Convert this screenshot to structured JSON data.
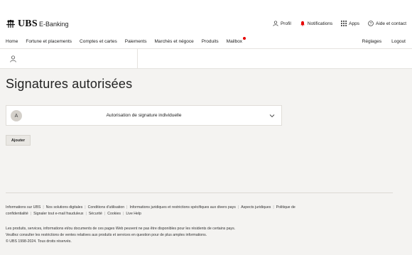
{
  "header": {
    "brand": "UBS",
    "app_name": "E-Banking",
    "actions": {
      "profile": "Profil",
      "notifications": "Notifications",
      "apps": "Apps",
      "help": "Aide et contact"
    },
    "icons": [
      "user-icon",
      "bell-icon",
      "grid-icon",
      "help-circle-icon"
    ],
    "accent_color": "#e60000"
  },
  "nav": {
    "items": [
      "Home",
      "Fortune et placements",
      "Comptes et cartes",
      "Paiements",
      "Marchés et négoce",
      "Produits",
      "Mailbox"
    ],
    "right": [
      "Réglages",
      "Logout"
    ]
  },
  "page": {
    "title": "Signatures autorisées",
    "signature": {
      "avatar_initial": "A",
      "label": "Autorisation de signature individuelle"
    },
    "add_button": "Ajouter"
  },
  "footer": {
    "links": [
      "Informations sur UBS",
      "Nos solutions digitales",
      "Conditions d'utilisation",
      "Informations juridiques et restrictions spécifiques aux divers pays",
      "Aspects juridiques",
      "Politique de confidentialité",
      "Signaler tout e-mail frauduleux",
      "Sécurité",
      "Cookies",
      "Live Help"
    ],
    "note_line1": "Les produits, services, informations et/ou documents de ces pages Web peuvent ne pas être disponibles pour les résidents de certains pays.",
    "note_line2": "Veuillez consulter les restrictions de ventes relatives aux produits et services en question pour de plus amples informations.",
    "copyright": "© UBS 1998-2024. Tous droits réservés."
  }
}
